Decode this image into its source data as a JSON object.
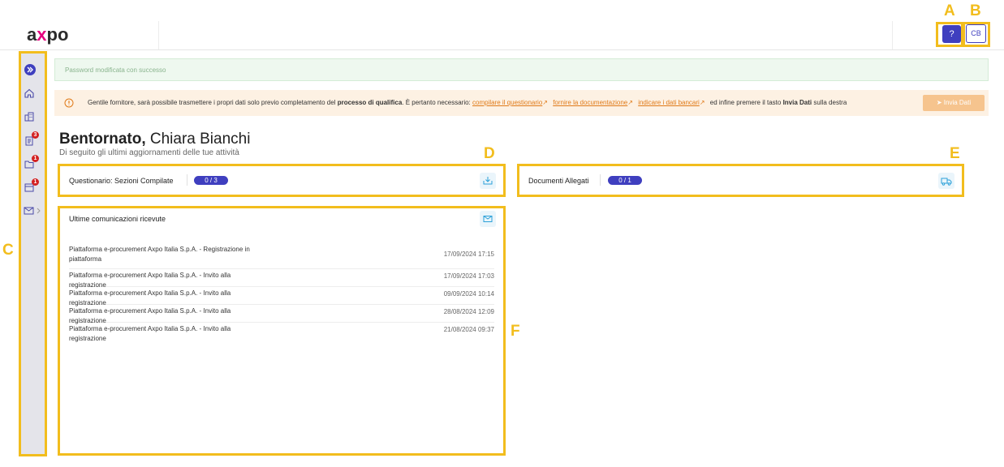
{
  "header": {
    "logo": {
      "a": "a",
      "x": "x",
      "po": "po"
    },
    "help_label": "?",
    "avatar_initials": "CB"
  },
  "sidebar": {
    "items": [
      {
        "icon": "expand-icon"
      },
      {
        "icon": "home-icon"
      },
      {
        "icon": "buildings-icon"
      },
      {
        "icon": "clipboard-icon",
        "badge": "3"
      },
      {
        "icon": "folder-icon",
        "badge": "1"
      },
      {
        "icon": "calendar-icon",
        "badge": "1"
      },
      {
        "icon": "mail-icon"
      }
    ]
  },
  "alerts": {
    "success": "Password modificata con successo",
    "warning": {
      "pre": "Gentile fornitore, sarà possibile trasmettere i propri dati solo previo completamento del ",
      "bold": "processo di qualifica",
      "mid": ". È pertanto necessario: ",
      "link1": "compilare il questionario",
      "link2": "fornire la documentazione",
      "link3": "indicare i dati bancari",
      "post": " ed infine premere il tasto ",
      "bold2": "Invia Dati",
      "end": " sulla destra"
    },
    "send_button": "Invia Dati"
  },
  "welcome": {
    "greeting": "Bentornato,",
    "name": " Chiara Bianchi",
    "subtitle": "Di seguito gli ultimi aggiornamenti delle tue attività"
  },
  "cards": {
    "questionnaire": {
      "title": "Questionario: Sezioni Compilate",
      "progress": "0 / 3"
    },
    "documents": {
      "title": "Documenti Allegati",
      "progress": "0 / 1"
    },
    "communications": {
      "title": "Ultime comunicazioni ricevute",
      "rows": [
        {
          "subject": "Piattaforma e-procurement Axpo Italia S.p.A. - Registrazione in piattaforma",
          "date": "17/09/2024 17:15"
        },
        {
          "subject": "Piattaforma e-procurement Axpo Italia S.p.A. - Invito alla registrazione",
          "date": "17/09/2024 17:03"
        },
        {
          "subject": "Piattaforma e-procurement Axpo Italia S.p.A. - Invito alla registrazione",
          "date": "09/09/2024 10:14"
        },
        {
          "subject": "Piattaforma e-procurement Axpo Italia S.p.A. - Invito alla registrazione",
          "date": "28/08/2024 12:09"
        },
        {
          "subject": "Piattaforma e-procurement Axpo Italia S.p.A. - Invito alla registrazione",
          "date": "21/08/2024 09:37"
        }
      ]
    }
  },
  "annotations": {
    "A": "A",
    "B": "B",
    "C": "C",
    "D": "D",
    "E": "E",
    "F": "F"
  },
  "colors": {
    "accent": "#3f3fbf",
    "annotation": "#f2bd1d",
    "warning_link": "#e07a18",
    "badge": "#d32020"
  }
}
